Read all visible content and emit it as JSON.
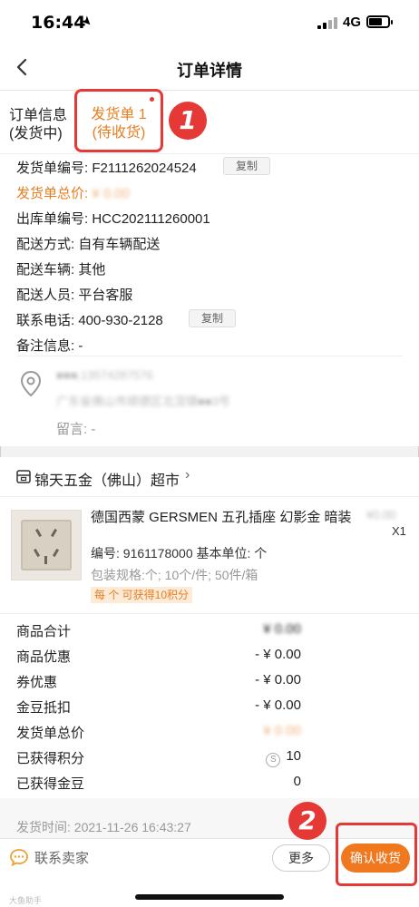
{
  "status_bar": {
    "time": "16:44",
    "network": "4G"
  },
  "nav": {
    "title": "订单详情"
  },
  "tabs": {
    "info_label": "订单信息\n(发货中)",
    "ship_label_1": "发货单 1",
    "ship_label_2": "(待收货)",
    "step1": "1"
  },
  "order_info": {
    "ship_no_label": "发货单编号:",
    "ship_no": "F2111262024524",
    "copy": "复制",
    "ship_total_label": "发货单总价:",
    "ship_total_value": "¥ 0.00",
    "outbound_label": "出库单编号:",
    "outbound_no": "HCC202111260001",
    "delivery_method_label": "配送方式:",
    "delivery_method": "自有车辆配送",
    "vehicle_label": "配送车辆:",
    "vehicle": "其他",
    "staff_label": "配送人员:",
    "staff": "平台客服",
    "phone_label": "联系电话:",
    "phone": "400-930-2128",
    "note_label": "备注信息:",
    "note": "-",
    "recipient": "■■■,13574287576",
    "address": "广东省佛山市顺德区北滘镇■■3号",
    "message_label": "留言:",
    "message": "-"
  },
  "shop": {
    "name": "锦天五金（佛山）超市"
  },
  "product": {
    "name": "德国西蒙 GERSMEN 五孔插座 幻影金 暗装",
    "price": "¥0.00",
    "qty": "X1",
    "code": "编号: 9161178000  基本单位: 个",
    "pack": "包装规格:个; 10个/件; 50件/箱",
    "points": "每 个 可获得10积分"
  },
  "summary": {
    "rows": [
      {
        "label": "商品合计",
        "value": "¥ 0.00"
      },
      {
        "label": "商品优惠",
        "value": "- ¥  0.00"
      },
      {
        "label": "券优惠",
        "value": "- ¥  0.00"
      },
      {
        "label": "金豆抵扣",
        "value": "- ¥  0.00"
      },
      {
        "label": "发货单总价",
        "value": "¥ 0.00"
      },
      {
        "label": "已获得积分",
        "value": "10"
      },
      {
        "label": "已获得金豆",
        "value": "0"
      }
    ]
  },
  "ship_time": "发货时间: 2021-11-26 16:43:27",
  "bottom": {
    "contact": "联系卖家",
    "more": "更多",
    "confirm": "确认收货",
    "step2": "2",
    "watermark": "大鱼助手"
  },
  "colors": {
    "accent": "#f0781e",
    "highlight": "#e53935",
    "orange_text": "#e67e22"
  }
}
